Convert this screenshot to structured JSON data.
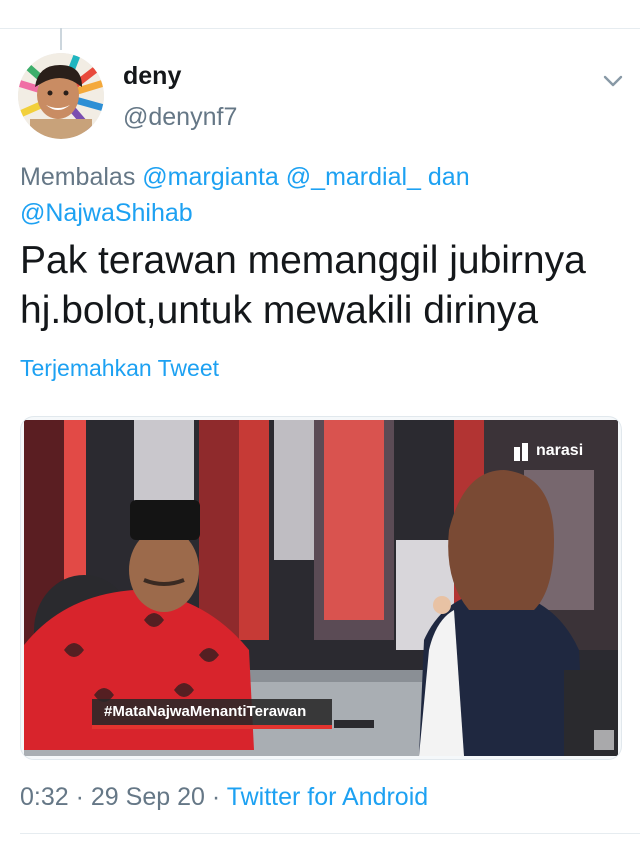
{
  "author": {
    "display_name": "deny",
    "handle": "@denynf7"
  },
  "reply": {
    "prefix": "Membalas",
    "mention_1": "@margianta",
    "mention_2": "@_mardial_",
    "conjunction": "dan",
    "mention_3": "@NajwaShihab"
  },
  "tweet": {
    "text_line_1": "Pak terawan memanggil jubirnya",
    "text_line_2": "hj.bolot,untuk mewakili dirinya",
    "translate_label": "Terjemahkan Tweet"
  },
  "media": {
    "hashtag": "#MataNajwaMenantiTerawan",
    "brand": "narasi"
  },
  "meta": {
    "time": "0:32",
    "date": "29 Sep 20",
    "separator": "·",
    "source": "Twitter for Android"
  },
  "colors": {
    "link": "#1da1f2",
    "secondary_text": "#657786",
    "primary_text": "#14171a",
    "accent_red": "#e3342f"
  },
  "icons": [
    "chevron-down-icon",
    "narasi-logo-icon"
  ]
}
